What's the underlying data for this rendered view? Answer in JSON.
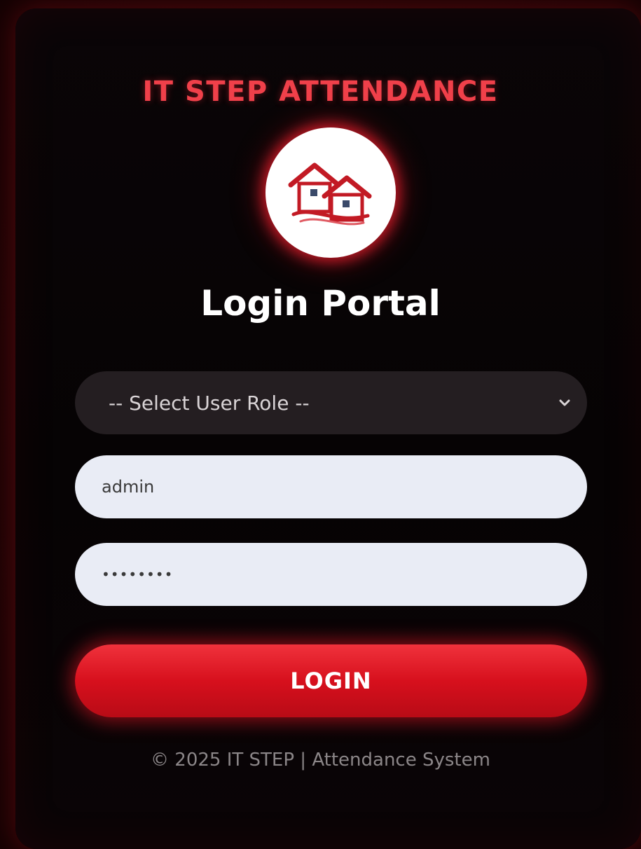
{
  "brand": {
    "name": "IT STEP ATTENDANCE",
    "logo_icon": "houses-icon",
    "accent_color": "#f0404a"
  },
  "page": {
    "title": "Login Portal"
  },
  "form": {
    "role_select": {
      "selected_label": "-- Select User Role --",
      "icon": "chevron-down-icon"
    },
    "username": {
      "value": "admin"
    },
    "password": {
      "value": "••••••••"
    },
    "login_button": {
      "label": "LOGIN",
      "color": "#d7101d"
    }
  },
  "footer": {
    "text": "© 2025 IT STEP | Attendance System"
  }
}
